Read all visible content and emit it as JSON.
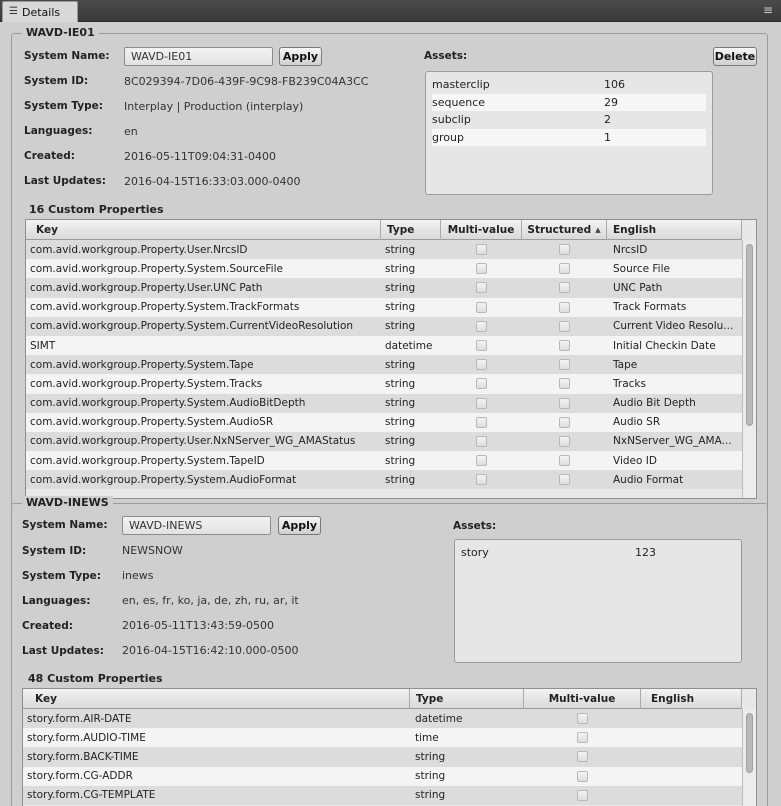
{
  "tab": {
    "label": "Details",
    "icon": "list-icon"
  },
  "menu_icon": "hamburger-icon",
  "labels": {
    "system_name": "System Name:",
    "system_id": "System ID:",
    "system_type": "System Type:",
    "languages": "Languages:",
    "created": "Created:",
    "last_updates": "Last Updates:",
    "assets": "Assets:",
    "apply": "Apply",
    "delete": "Delete"
  },
  "system1": {
    "title": "WAVD-IE01",
    "name_value": "WAVD-IE01",
    "system_id": "8C029394-7D06-439F-9C98-FB239C04A3CC",
    "system_type": "Interplay | Production (interplay)",
    "languages": "en",
    "created": "2016-05-11T09:04:31-0400",
    "last_updates": "2016-04-15T16:33:03.000-0400",
    "assets": [
      {
        "name": "masterclip",
        "count": "106"
      },
      {
        "name": "sequence",
        "count": "29"
      },
      {
        "name": "subclip",
        "count": "2"
      },
      {
        "name": "group",
        "count": "1"
      }
    ],
    "custom_title": "16 Custom Properties",
    "columns": {
      "key": "Key",
      "type": "Type",
      "multi": "Multi-value",
      "structured": "Structured",
      "english": "English"
    },
    "sort_indicator": "▲",
    "rows": [
      {
        "key": "com.avid.workgroup.Property.User.NrcsID",
        "type": "string",
        "english": "NrcsID"
      },
      {
        "key": "com.avid.workgroup.Property.System.SourceFile",
        "type": "string",
        "english": "Source File"
      },
      {
        "key": "com.avid.workgroup.Property.User.UNC Path",
        "type": "string",
        "english": "UNC Path"
      },
      {
        "key": "com.avid.workgroup.Property.System.TrackFormats",
        "type": "string",
        "english": "Track Formats"
      },
      {
        "key": "com.avid.workgroup.Property.System.CurrentVideoResolution",
        "type": "string",
        "english": "Current Video Resolu..."
      },
      {
        "key": "SIMT",
        "type": "datetime",
        "english": "Initial Checkin Date"
      },
      {
        "key": "com.avid.workgroup.Property.System.Tape",
        "type": "string",
        "english": "Tape"
      },
      {
        "key": "com.avid.workgroup.Property.System.Tracks",
        "type": "string",
        "english": "Tracks"
      },
      {
        "key": "com.avid.workgroup.Property.System.AudioBitDepth",
        "type": "string",
        "english": "Audio Bit Depth"
      },
      {
        "key": "com.avid.workgroup.Property.System.AudioSR",
        "type": "string",
        "english": "Audio SR"
      },
      {
        "key": "com.avid.workgroup.Property.User.NxNServer_WG_AMAStatus",
        "type": "string",
        "english": "NxNServer_WG_AMA..."
      },
      {
        "key": "com.avid.workgroup.Property.System.TapeID",
        "type": "string",
        "english": "Video ID"
      },
      {
        "key": "com.avid.workgroup.Property.System.AudioFormat",
        "type": "string",
        "english": "Audio Format"
      }
    ]
  },
  "system2": {
    "title": "WAVD-INEWS",
    "name_value": "WAVD-INEWS",
    "system_id": "NEWSNOW",
    "system_type": "inews",
    "languages": "en, es, fr, ko, ja, de, zh, ru, ar, it",
    "created": "2016-05-11T13:43:59-0500",
    "last_updates": "2016-04-15T16:42:10.000-0500",
    "assets": [
      {
        "name": "story",
        "count": "123"
      }
    ],
    "custom_title": "48 Custom Properties",
    "columns": {
      "key": "Key",
      "type": "Type",
      "multi": "Multi-value",
      "english": "English"
    },
    "rows": [
      {
        "key": "story.form.AIR-DATE",
        "type": "datetime",
        "english": ""
      },
      {
        "key": "story.form.AUDIO-TIME",
        "type": "time",
        "english": ""
      },
      {
        "key": "story.form.BACK-TIME",
        "type": "string",
        "english": ""
      },
      {
        "key": "story.form.CG-ADDR",
        "type": "string",
        "english": ""
      },
      {
        "key": "story.form.CG-TEMPLATE",
        "type": "string",
        "english": ""
      }
    ]
  }
}
